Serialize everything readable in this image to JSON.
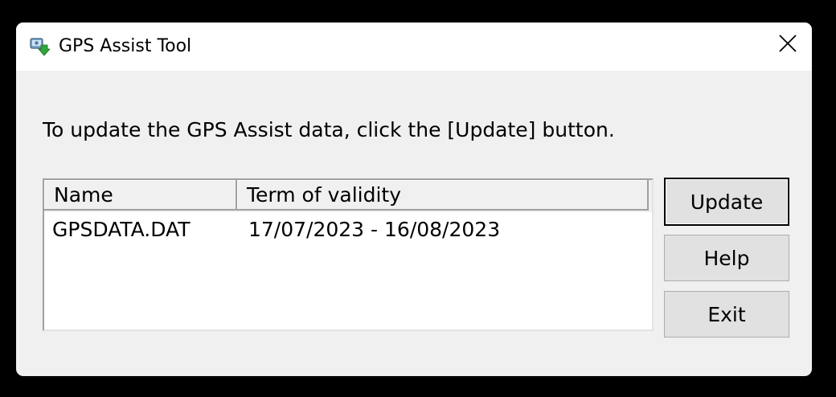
{
  "window": {
    "title": "GPS Assist Tool",
    "app_icon": "gps-assist-app-icon",
    "close_icon": "close-icon"
  },
  "instruction": "To update the GPS Assist data, click the [Update] button.",
  "list": {
    "columns": [
      "Name",
      "Term of validity"
    ],
    "rows": [
      {
        "name": "GPSDATA.DAT",
        "term": "17/07/2023 - 16/08/2023"
      }
    ]
  },
  "buttons": {
    "update": "Update",
    "help": "Help",
    "exit": "Exit"
  },
  "colors": {
    "window_bg": "#f0f0f0",
    "titlebar_bg": "#ffffff",
    "button_bg": "#e1e1e1",
    "backdrop": "#000000"
  }
}
